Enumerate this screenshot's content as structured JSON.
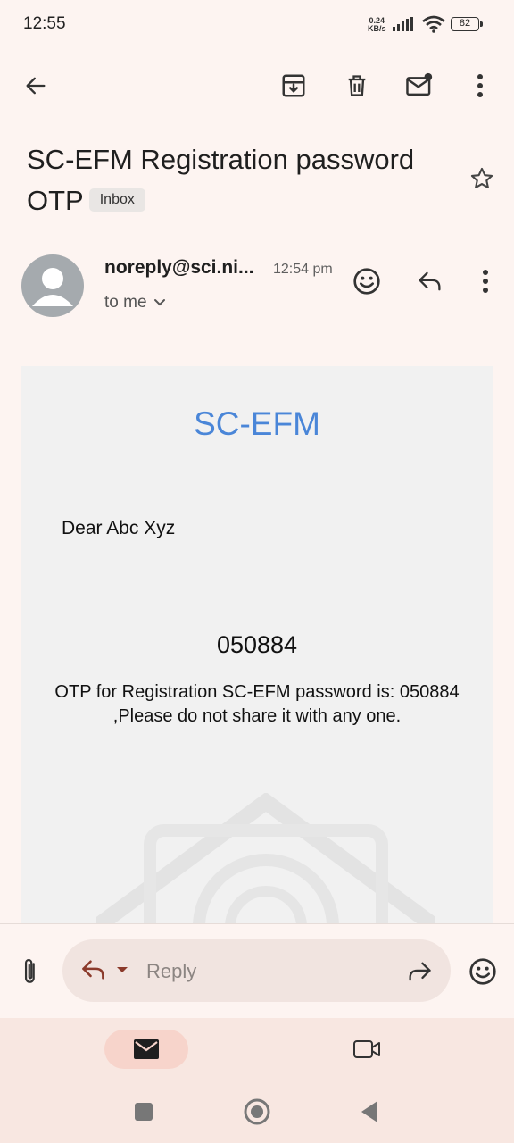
{
  "status_bar": {
    "time": "12:55",
    "net_speed_value": "0.24",
    "net_speed_unit": "KB/s",
    "battery": "82"
  },
  "toolbar": {
    "back_icon": "arrow-left-icon",
    "archive_icon": "archive-icon",
    "delete_icon": "trash-icon",
    "mark_unread_icon": "mail-unread-icon",
    "more_icon": "more-vertical-icon"
  },
  "subject": {
    "text": "SC-EFM Registration password OTP",
    "label": "Inbox",
    "star_icon": "star-outline-icon"
  },
  "sender": {
    "name": "noreply@sci.ni...",
    "time": "12:54 pm",
    "recipient": "to me",
    "emoji_icon": "emoji-icon",
    "reply_icon": "reply-icon",
    "more_icon": "more-vertical-icon"
  },
  "email_body": {
    "brand": "SC-EFM",
    "greeting": "Dear Abc Xyz",
    "otp_code": "050884",
    "message": "OTP for Registration SC-EFM password is: 050884 ,Please do not share it with any one."
  },
  "reply_bar": {
    "attach_icon": "paperclip-icon",
    "placeholder": "Reply",
    "forward_icon": "forward-icon",
    "emoji_icon": "emoji-icon"
  },
  "bottom_nav": {
    "items": [
      {
        "icon": "mail-icon",
        "selected": true
      },
      {
        "icon": "video-icon",
        "selected": false
      }
    ]
  },
  "system_nav": {
    "items": [
      "recents-icon",
      "home-icon",
      "back-icon"
    ]
  },
  "colors": {
    "background": "#fdf4f1",
    "brand_blue": "#4a86d8",
    "card": "#f1f1f1",
    "accent_pill": "#f7d4cb",
    "reply_accent": "#8b3a2b"
  }
}
